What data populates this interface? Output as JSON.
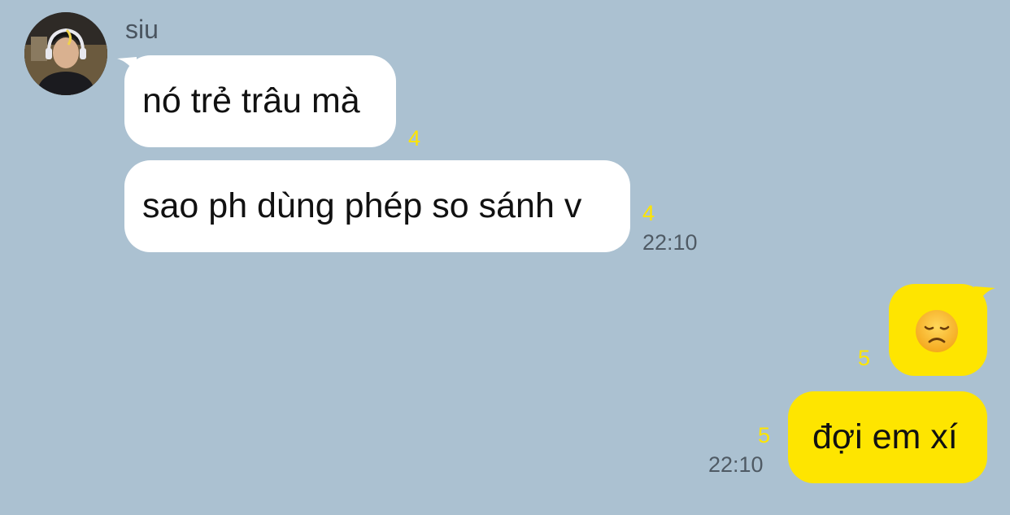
{
  "chat": {
    "sender": {
      "name": "siu",
      "avatar": "avatar-photo"
    },
    "incoming": [
      {
        "text": "nó trẻ trâu mà",
        "unread_count": "4"
      },
      {
        "text": "sao ph dùng phép so sánh v",
        "unread_count": "4",
        "time": "22:10"
      }
    ],
    "outgoing": [
      {
        "emoji": "disappointed-face",
        "unread_count": "5"
      },
      {
        "text": "đợi em xí",
        "unread_count": "5",
        "time": "22:10"
      }
    ]
  },
  "colors": {
    "background": "#abc1d1",
    "incoming_bubble": "#ffffff",
    "outgoing_bubble": "#fee500",
    "unread_count": "#fee500",
    "timestamp": "#4f5a64"
  }
}
